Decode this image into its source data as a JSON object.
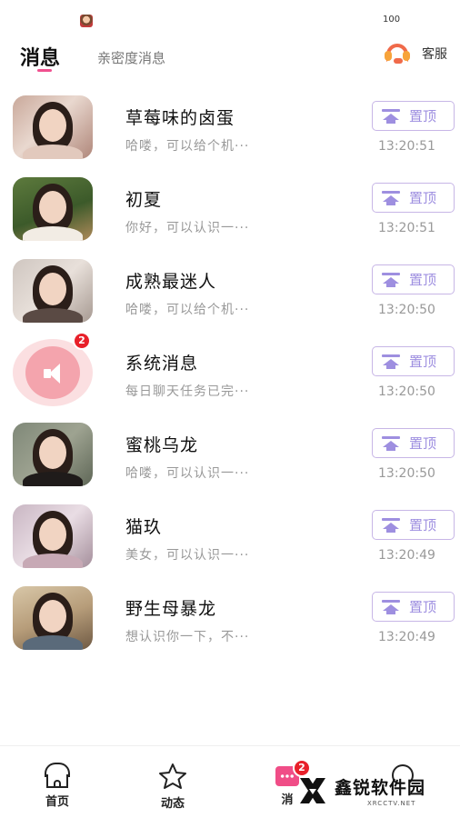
{
  "status_bar": {
    "battery": "100"
  },
  "header": {
    "tab_messages": "消息",
    "tab_intimacy": "亲密度消息",
    "service_label": "客服"
  },
  "conversations": [
    {
      "name": "草莓味的卤蛋",
      "preview": "哈喽，可以给个机···",
      "time": "13:20:51",
      "pin_label": "置顶"
    },
    {
      "name": "初夏",
      "preview": "你好，可以认识一···",
      "time": "13:20:51",
      "pin_label": "置顶"
    },
    {
      "name": "成熟最迷人",
      "preview": "哈喽，可以给个机···",
      "time": "13:20:50",
      "pin_label": "置顶"
    },
    {
      "name": "系统消息",
      "preview": "每日聊天任务已完···",
      "time": "13:20:50",
      "pin_label": "置顶",
      "badge": "2"
    },
    {
      "name": "蜜桃乌龙",
      "preview": "哈喽，可以认识一···",
      "time": "13:20:50",
      "pin_label": "置顶"
    },
    {
      "name": "猫玖",
      "preview": "美女，可以认识一···",
      "time": "13:20:49",
      "pin_label": "置顶"
    },
    {
      "name": "野生母暴龙",
      "preview": "想认识你一下，不···",
      "time": "13:20:49",
      "pin_label": "置顶"
    }
  ],
  "tabbar": {
    "home": "首页",
    "feed": "动态",
    "messages": "消",
    "messages_badge": "2"
  },
  "watermark": {
    "text": "鑫锐软件园",
    "url": "XRCCTV.NET"
  },
  "colors": {
    "accent_pink": "#f0508f",
    "pin_purple": "#9e8fe0",
    "badge_red": "#e8202a"
  }
}
